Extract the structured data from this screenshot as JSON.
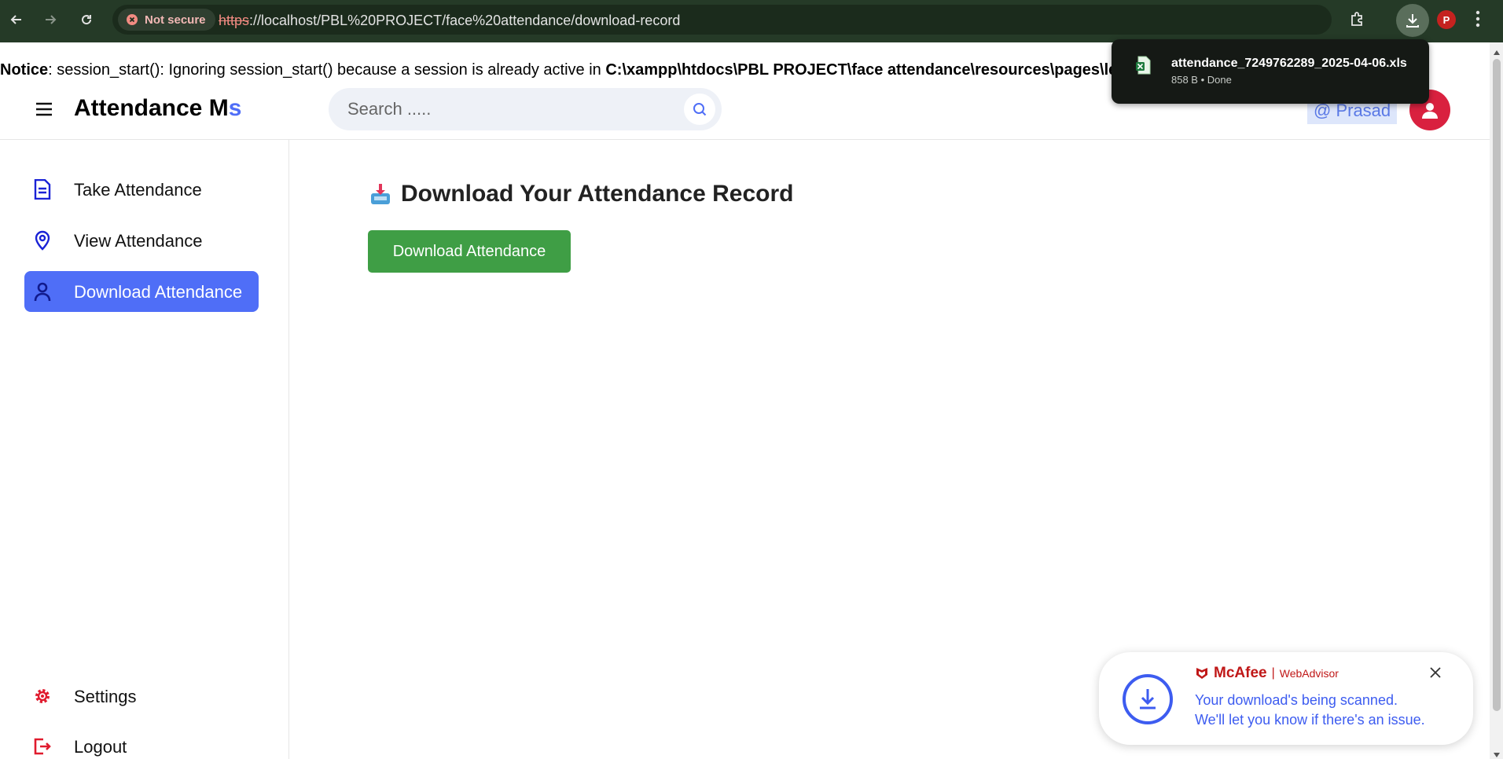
{
  "browser": {
    "security_label": "Not secure",
    "url_scheme": "https",
    "url_rest": "://localhost/PBL%20PROJECT/face%20attendance/download-record",
    "profile_initial": "P"
  },
  "download_popup": {
    "filename": "attendance_7249762289_2025-04-06.xls",
    "meta": "858 B • Done"
  },
  "notice": {
    "label": "Notice",
    "message": ": session_start(): Ignoring session_start() because a session is already active in ",
    "path": "C:\\xampp\\htdocs\\PBL PROJECT\\face attendance\\resources\\pages\\lectu"
  },
  "header": {
    "brand_main": "Attendance M",
    "brand_accent": "s",
    "search_placeholder": "Search .....",
    "user_badge": "@ Prasad"
  },
  "sidebar": {
    "items": [
      {
        "label": "Take Attendance",
        "icon": "document-icon"
      },
      {
        "label": "View Attendance",
        "icon": "location-pin-icon"
      },
      {
        "label": "Download Attendance",
        "icon": "user-icon",
        "active": true
      }
    ],
    "bottom": [
      {
        "label": "Settings",
        "icon": "gear-icon"
      },
      {
        "label": "Logout",
        "icon": "logout-icon"
      }
    ]
  },
  "main": {
    "title": "Download Your Attendance Record",
    "download_button": "Download Attendance"
  },
  "toast": {
    "brand": "McAfee",
    "product": "WebAdvisor",
    "line1": "Your download's being scanned.",
    "line2": "We'll let you know if there's an issue."
  },
  "colors": {
    "accent": "#4f6ef7",
    "button_green": "#3f9e45",
    "avatar_red": "#d9213f",
    "mcafee_red": "#c01818"
  }
}
